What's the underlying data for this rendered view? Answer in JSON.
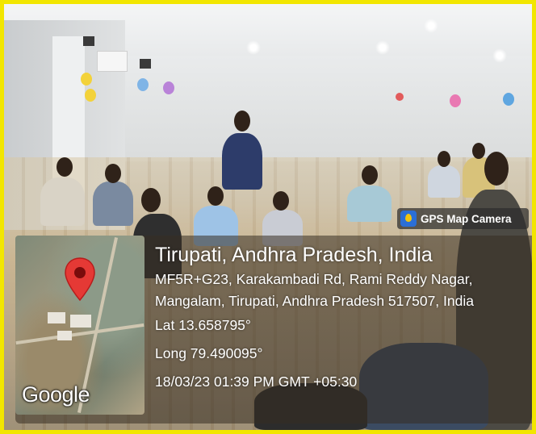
{
  "badge": {
    "label": "GPS Map Camera",
    "icon": "gps-map-camera-app-icon"
  },
  "map": {
    "logo_text": "Google",
    "pin_color": "#e53935"
  },
  "location": {
    "title": "Tirupati, Andhra Pradesh, India",
    "address_line_1": "MF5R+G23, Karakambadi Rd, Rami Reddy Nagar,",
    "address_line_2": "Mangalam, Tirupati, Andhra Pradesh 517507, India",
    "latitude": "Lat 13.658795°",
    "longitude": "Long 79.490095°",
    "timestamp": "18/03/23 01:39 PM GMT +05:30"
  },
  "colors": {
    "frame": "#f2e600",
    "overlay": "#372d23"
  }
}
